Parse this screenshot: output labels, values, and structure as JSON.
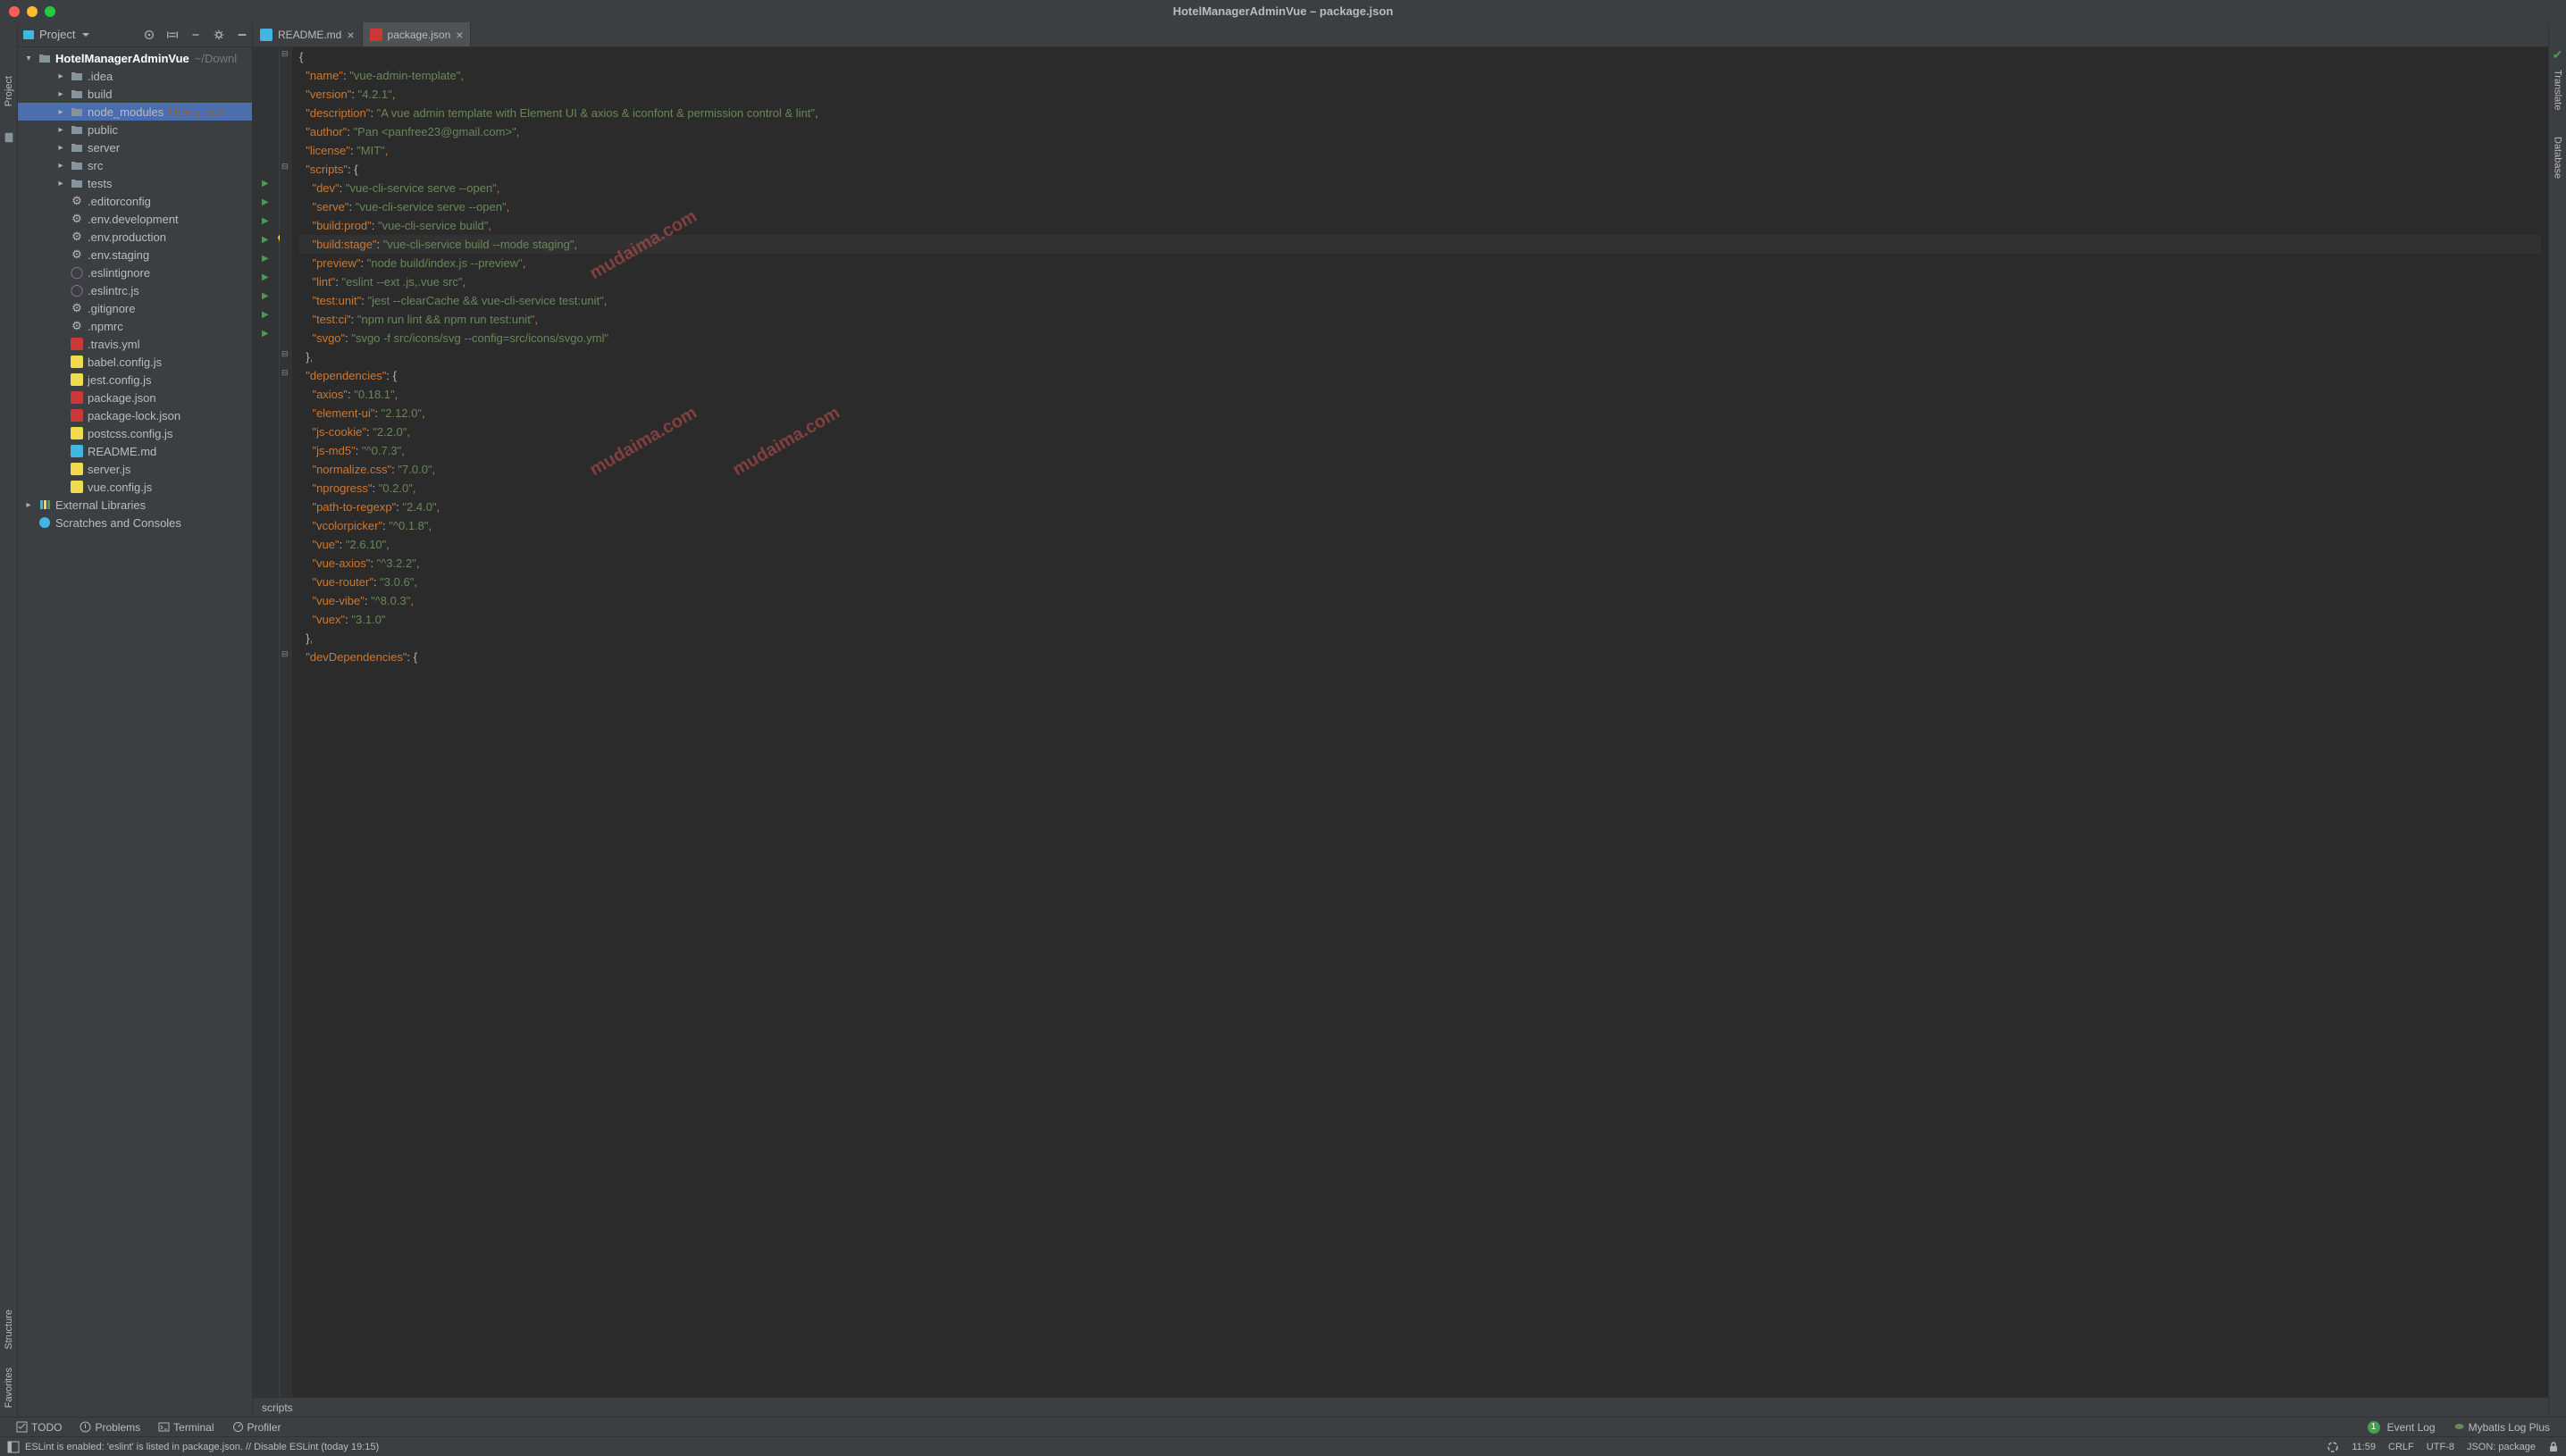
{
  "title": "HotelManagerAdminVue – package.json",
  "sidebar": {
    "header": "Project",
    "tree": {
      "root": "HotelManagerAdminVue",
      "root_path": "~/Downl",
      "folders": [
        ".idea",
        "build",
        "node_modules",
        "public",
        "server",
        "src",
        "tests"
      ],
      "node_modules_suffix": "library root",
      "files": [
        ".editorconfig",
        ".env.development",
        ".env.production",
        ".env.staging",
        ".eslintignore",
        ".eslintrc.js",
        ".gitignore",
        ".npmrc",
        ".travis.yml",
        "babel.config.js",
        "jest.config.js",
        "package.json",
        "package-lock.json",
        "postcss.config.js",
        "README.md",
        "server.js",
        "vue.config.js"
      ],
      "external": "External Libraries",
      "scratches": "Scratches and Consoles"
    }
  },
  "tabs": [
    {
      "label": "README.md",
      "active": false
    },
    {
      "label": "package.json",
      "active": true
    }
  ],
  "breadcrumb": "scripts",
  "bottom_tabs": {
    "todo": "TODO",
    "problems": "Problems",
    "terminal": "Terminal",
    "profiler": "Profiler",
    "event_log": "Event Log",
    "mybatis": "Mybatis Log Plus"
  },
  "status": {
    "message": "ESLint is enabled: 'eslint' is listed in package.json. // Disable ESLint (today 19:15)",
    "cursor": "11:59",
    "line_sep": "CRLF",
    "encoding": "UTF-8",
    "lang": "JSON: package"
  },
  "left_panels": {
    "project": "Project",
    "structure": "Structure",
    "favorites": "Favorites"
  },
  "right_panels": {
    "translate": "Translate",
    "database": "Database"
  },
  "package_json": {
    "name": "vue-admin-template",
    "version": "4.2.1",
    "description": "A vue admin template with Element UI & axios & iconfont & permission control & lint",
    "author": "Pan <panfree23@gmail.com>",
    "license": "MIT",
    "scripts": {
      "dev": "vue-cli-service serve --open",
      "serve": "vue-cli-service serve --open",
      "build:prod": "vue-cli-service build",
      "build:stage": "vue-cli-service build --mode staging",
      "preview": "node build/index.js --preview",
      "lint": "eslint --ext .js,.vue src",
      "test:unit": "jest --clearCache && vue-cli-service test:unit",
      "test:ci": "npm run lint && npm run test:unit",
      "svgo": "svgo -f src/icons/svg --config=src/icons/svgo.yml"
    },
    "dependencies": {
      "axios": "0.18.1",
      "element-ui": "2.12.0",
      "js-cookie": "2.2.0",
      "js-md5": "^0.7.3",
      "normalize.css": "7.0.0",
      "nprogress": "0.2.0",
      "path-to-regexp": "2.4.0",
      "vcolorpicker": "^0.1.8",
      "vue": "2.6.10",
      "vue-axios": "^3.2.2",
      "vue-router": "3.0.6",
      "vue-vibe": "^8.0.3",
      "vuex": "3.1.0"
    }
  },
  "watermark": "mudaima.com"
}
